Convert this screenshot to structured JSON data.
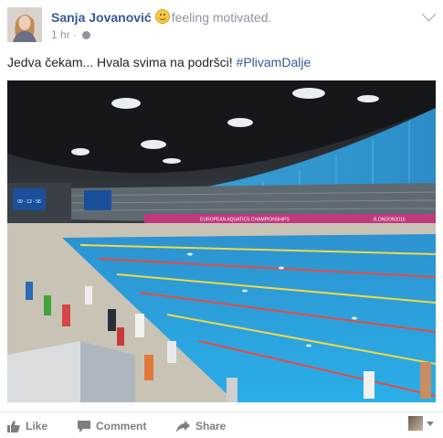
{
  "post": {
    "author": "Sanja Jovanović",
    "feeling": "feeling motivated.",
    "time": "1 hr",
    "text": "Jedva čekam... Hvala svima na podršci! ",
    "hashtag": "#PlivamDalje"
  },
  "photo": {
    "scoreboard_left": "09 - 13 - 56",
    "banner": "EUROPEAN AQUATICS CHAMPIONSHIPS",
    "banner_right": "#LONDON2016"
  },
  "actions": {
    "like": "Like",
    "comment": "Comment",
    "share": "Share"
  },
  "icons": {
    "avatar": "avatar",
    "emoji": "smile-emoji-icon",
    "audience": "globe-icon",
    "menu": "chevron-down-icon",
    "like": "thumbs-up-icon",
    "comment": "speech-bubble-icon",
    "share": "share-arrow-icon"
  },
  "colors": {
    "link": "#365899",
    "muted": "#90949c",
    "pool": "#2a9ad8"
  }
}
